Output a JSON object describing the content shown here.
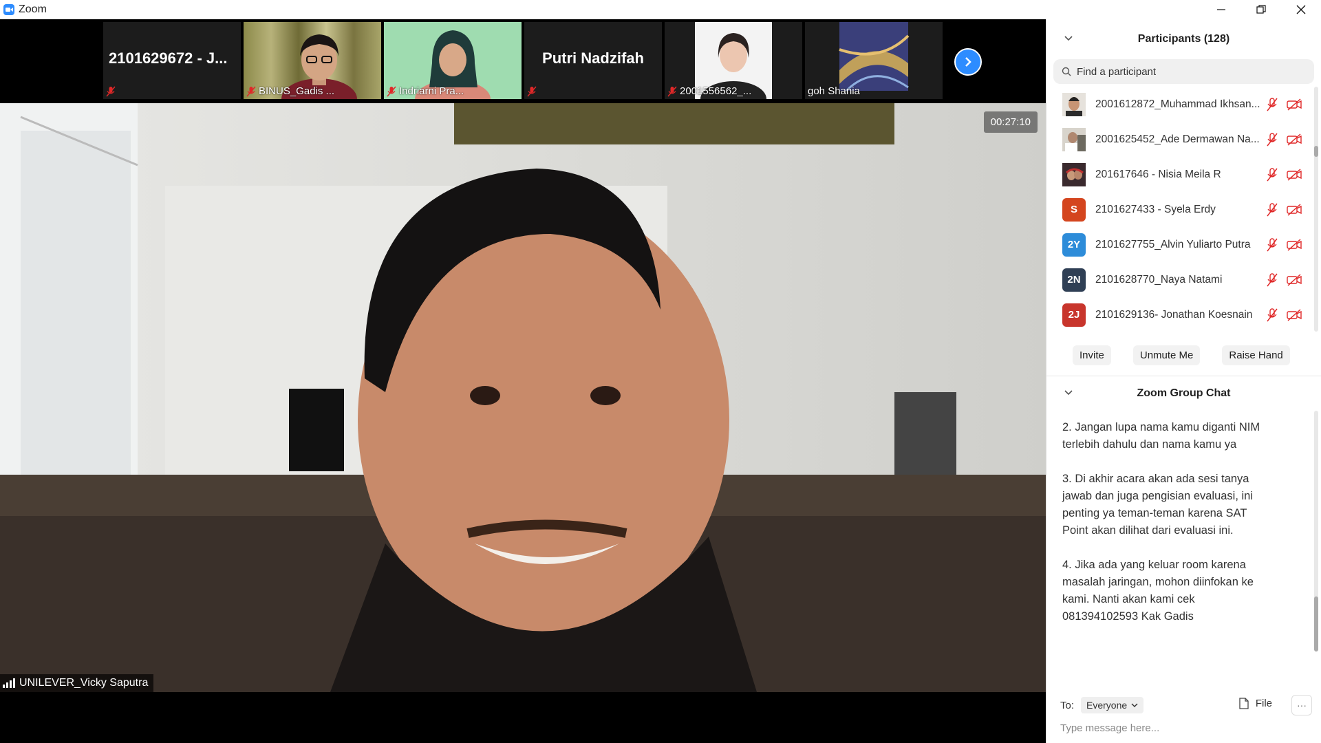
{
  "window": {
    "title": "Zoom"
  },
  "thumbnails": [
    {
      "label": "",
      "big_name": "2101629672 - J...",
      "muted": true,
      "style": "name-only"
    },
    {
      "label": "BINUS_Gadis ...",
      "big_name": "",
      "muted": true,
      "style": "video"
    },
    {
      "label": "Indriarni Pra...",
      "big_name": "",
      "muted": true,
      "style": "video"
    },
    {
      "label": "",
      "big_name": "Putri Nadzifah",
      "muted": true,
      "style": "name-only"
    },
    {
      "label": "2001556562_...",
      "big_name": "",
      "muted": true,
      "style": "video"
    },
    {
      "label": "goh Shania",
      "big_name": "",
      "muted": false,
      "style": "video"
    }
  ],
  "main_video": {
    "timer": "00:27:10",
    "speaker": "UNILEVER_Vicky Saputra"
  },
  "participants": {
    "header": "Participants (128)",
    "search_placeholder": "Find a participant",
    "list": [
      {
        "name": "2001612872_Muhammad Ikhsan...",
        "avatar_text": "",
        "avatar_color": "#5a4030"
      },
      {
        "name": "2001625452_Ade Dermawan Na...",
        "avatar_text": "",
        "avatar_color": "#8a8a80"
      },
      {
        "name": "201617646 - Nisia Meila R",
        "avatar_text": "",
        "avatar_color": "#5c3a3a"
      },
      {
        "name": "2101627433 - Syela Erdy",
        "avatar_text": "S",
        "avatar_color": "#D4451E"
      },
      {
        "name": "2101627755_Alvin Yuliarto Putra",
        "avatar_text": "2Y",
        "avatar_color": "#2D8CD9"
      },
      {
        "name": "2101628770_Naya Natami",
        "avatar_text": "2N",
        "avatar_color": "#2F3F55"
      },
      {
        "name": "2101629136- Jonathan Koesnain",
        "avatar_text": "2J",
        "avatar_color": "#C8352C"
      }
    ],
    "buttons": {
      "invite": "Invite",
      "unmute": "Unmute Me",
      "raise_hand": "Raise Hand"
    }
  },
  "chat": {
    "header": "Zoom Group Chat",
    "messages": [
      "2. Jangan lupa nama kamu diganti NIM\nterlebih dahulu dan nama kamu ya",
      "3. Di akhir acara akan ada sesi tanya\njawab dan juga pengisian evaluasi, ini\npenting ya teman-teman karena SAT\nPoint akan dilihat dari evaluasi ini.",
      "4. Jika ada yang keluar room karena\nmasalah jaringan, mohon diinfokan ke\nkami. Nanti akan kami cek\n081394102593 Kak Gadis"
    ],
    "to_label": "To:",
    "to_value": "Everyone",
    "file_label": "File",
    "input_placeholder": "Type message here..."
  },
  "colors": {
    "accent": "#2D8CFF",
    "muted_red": "#E02828"
  }
}
